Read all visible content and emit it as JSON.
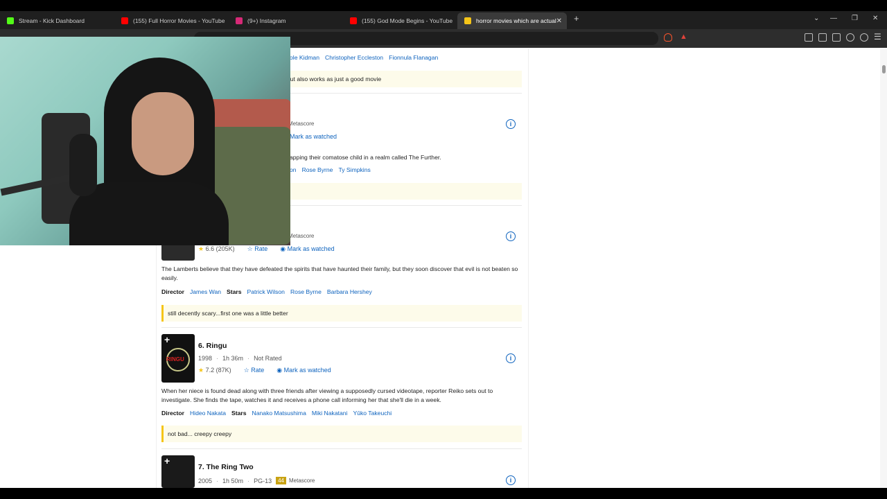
{
  "browser": {
    "tabs": [
      {
        "title": "Stream - Kick Dashboard",
        "icon": "kick-icon",
        "color": "#53fc18"
      },
      {
        "title": "(155) Full Horror Movies - YouTube",
        "icon": "youtube-icon",
        "color": "#ff0000"
      },
      {
        "title": "(9+) Instagram",
        "icon": "instagram-icon",
        "color": "#d62976"
      },
      {
        "title": "(155) God Mode Begins - YouTube",
        "icon": "youtube-icon",
        "color": "#ff0000"
      },
      {
        "title": "horror movies which are actually",
        "icon": "imdb-icon",
        "color": "#f5c518"
      }
    ],
    "new_tab": "+",
    "window_controls": [
      "⌄",
      "—",
      "❐",
      "✕"
    ]
  },
  "list": {
    "entry_top": {
      "stars_tail": [
        "ole Kidman",
        "Christopher Eccleston",
        "Fionnula Flanagan"
      ],
      "note": "but also works as just a good movie"
    },
    "entry_insidious": {
      "metascore_label": "Metascore",
      "watch": "Mark as watched",
      "desc_tail": "apping their comatose child in a realm called The Further.",
      "stars_tail": [
        "on",
        "Rose Byrne",
        "Ty Simpkins"
      ]
    },
    "entry_chapter2": {
      "metascore_label": "Metascore",
      "rating": "6.6 (205K)",
      "rate": "Rate",
      "watch": "Mark as watched",
      "desc": "The Lamberts believe that they have defeated the spirits that have haunted their family, but they soon discover that evil is not beaten so easily.",
      "director_label": "Director",
      "director": "James Wan",
      "stars_label": "Stars",
      "stars": [
        "Patrick Wilson",
        "Rose Byrne",
        "Barbara Hershey"
      ],
      "note": "still decently scary...first one was a little better"
    },
    "entry_ringu": {
      "title": "6. Ringu",
      "year": "1998",
      "runtime": "1h 36m",
      "cert": "Not Rated",
      "rating": "7.2 (87K)",
      "rate": "Rate",
      "watch": "Mark as watched",
      "poster_text": "RINGU",
      "desc": "When her niece is found dead along with three friends after viewing a supposedly cursed videotape, reporter Reiko sets out to investigate. She finds the tape, watches it and receives a phone call informing her that she'll die in a week.",
      "director_label": "Director",
      "director": "Hideo Nakata",
      "stars_label": "Stars",
      "stars": [
        "Nanako Matsushima",
        "Miki Nakatani",
        "Yûko Takeuchi"
      ],
      "note": "not bad... creepy creepy"
    },
    "entry_ring_two": {
      "title": "7. The Ring Two",
      "year": "2005",
      "runtime": "1h 50m",
      "cert": "PG-13",
      "metascore": "44",
      "metascore_label": "Metascore"
    }
  }
}
